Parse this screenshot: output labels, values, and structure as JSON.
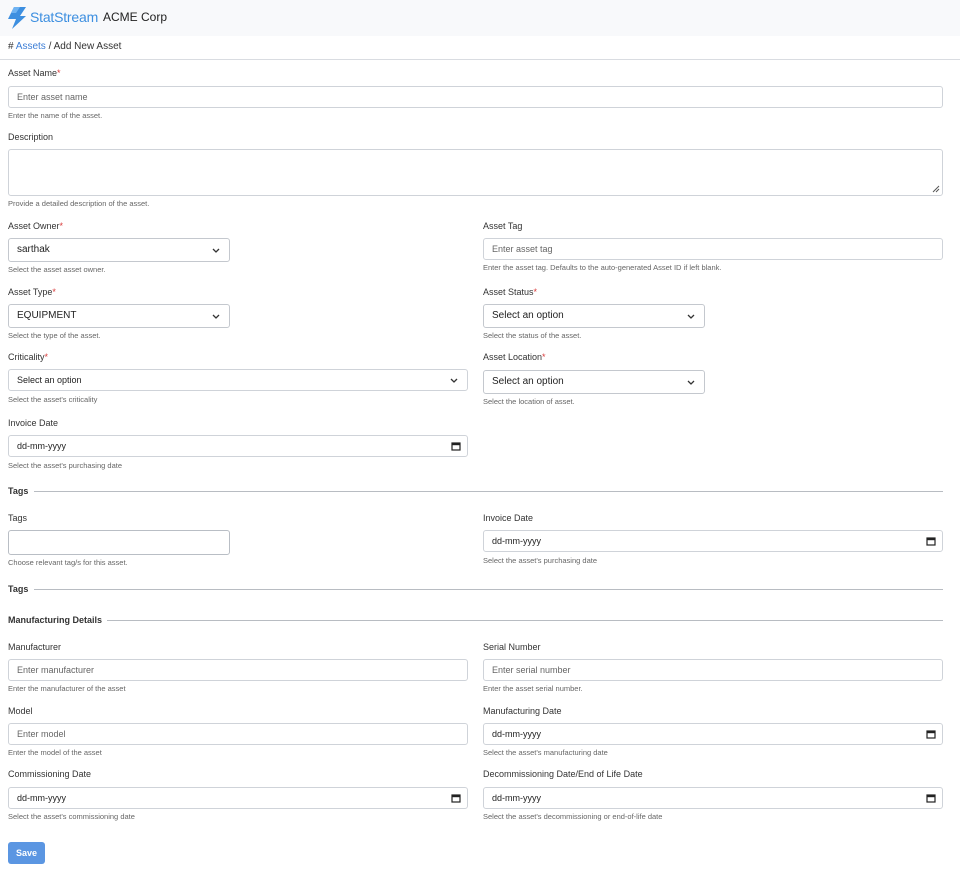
{
  "brand": {
    "name": "StatStream",
    "org": "ACME Corp",
    "color": "#3d8fe0"
  },
  "breadcrumb": {
    "hash": "#",
    "link": "Assets",
    "sep": "/",
    "current": "Add New Asset"
  },
  "form": {
    "asset_name": {
      "label": "Asset Name",
      "required": "*",
      "placeholder": "Enter asset name",
      "help": "Enter the name of the asset."
    },
    "description": {
      "label": "Description",
      "help": "Provide a detailed description of the asset."
    },
    "asset_owner": {
      "label": "Asset Owner",
      "required": "*",
      "value": "sarthak",
      "help": "Select the asset asset owner."
    },
    "asset_tag": {
      "label": "Asset Tag",
      "placeholder": "Enter asset tag",
      "help": "Enter the asset tag. Defaults to the auto-generated Asset ID if left blank."
    },
    "asset_type": {
      "label": "Asset Type",
      "required": "*",
      "value": "EQUIPMENT",
      "help": "Select the type of the asset."
    },
    "asset_status": {
      "label": "Asset Status",
      "required": "*",
      "value": "Select an option",
      "help": "Select the status of the asset."
    },
    "criticality": {
      "label": "Criticality",
      "required": "*",
      "value": "Select an option",
      "help": "Select the asset's criticality"
    },
    "asset_location": {
      "label": "Asset Location",
      "required": "*",
      "value": "Select an option",
      "help": "Select the location of asset."
    },
    "invoice_date": {
      "label": "Invoice Date",
      "value": "dd-mm-yyyy",
      "help": "Select the asset's purchasing date"
    }
  },
  "tags_section": {
    "title": "Tags",
    "tags": {
      "label": "Tags",
      "help": "Choose relevant tag/s for this asset."
    },
    "invoice_date": {
      "label": "Invoice Date",
      "value": "dd-mm-yyyy",
      "help": "Select the asset's purchasing date"
    },
    "title2": "Tags"
  },
  "manufacturing": {
    "title": "Manufacturing Details",
    "manufacturer": {
      "label": "Manufacturer",
      "placeholder": "Enter manufacturer",
      "help": "Enter the manufacturer of the asset"
    },
    "serial_number": {
      "label": "Serial Number",
      "placeholder": "Enter serial number",
      "help": "Enter the asset serial number."
    },
    "model": {
      "label": "Model",
      "placeholder": "Enter model",
      "help": "Enter the model of the asset"
    },
    "manufacturing_date": {
      "label": "Manufacturing Date",
      "value": "dd-mm-yyyy",
      "help": "Select the asset's manufacturing date"
    },
    "commissioning_date": {
      "label": "Commissioning Date",
      "value": "dd-mm-yyyy",
      "help": "Select the asset's commissioning date"
    },
    "decommissioning_date": {
      "label": "Decommissioning Date/End of Life Date",
      "value": "dd-mm-yyyy",
      "help": "Select the asset's decommissioning or end-of-life date"
    }
  },
  "actions": {
    "save": "Save",
    "save_color": "#5b96e2"
  },
  "colors": {
    "required": "#d93a3a",
    "link": "#3d7ed6"
  }
}
